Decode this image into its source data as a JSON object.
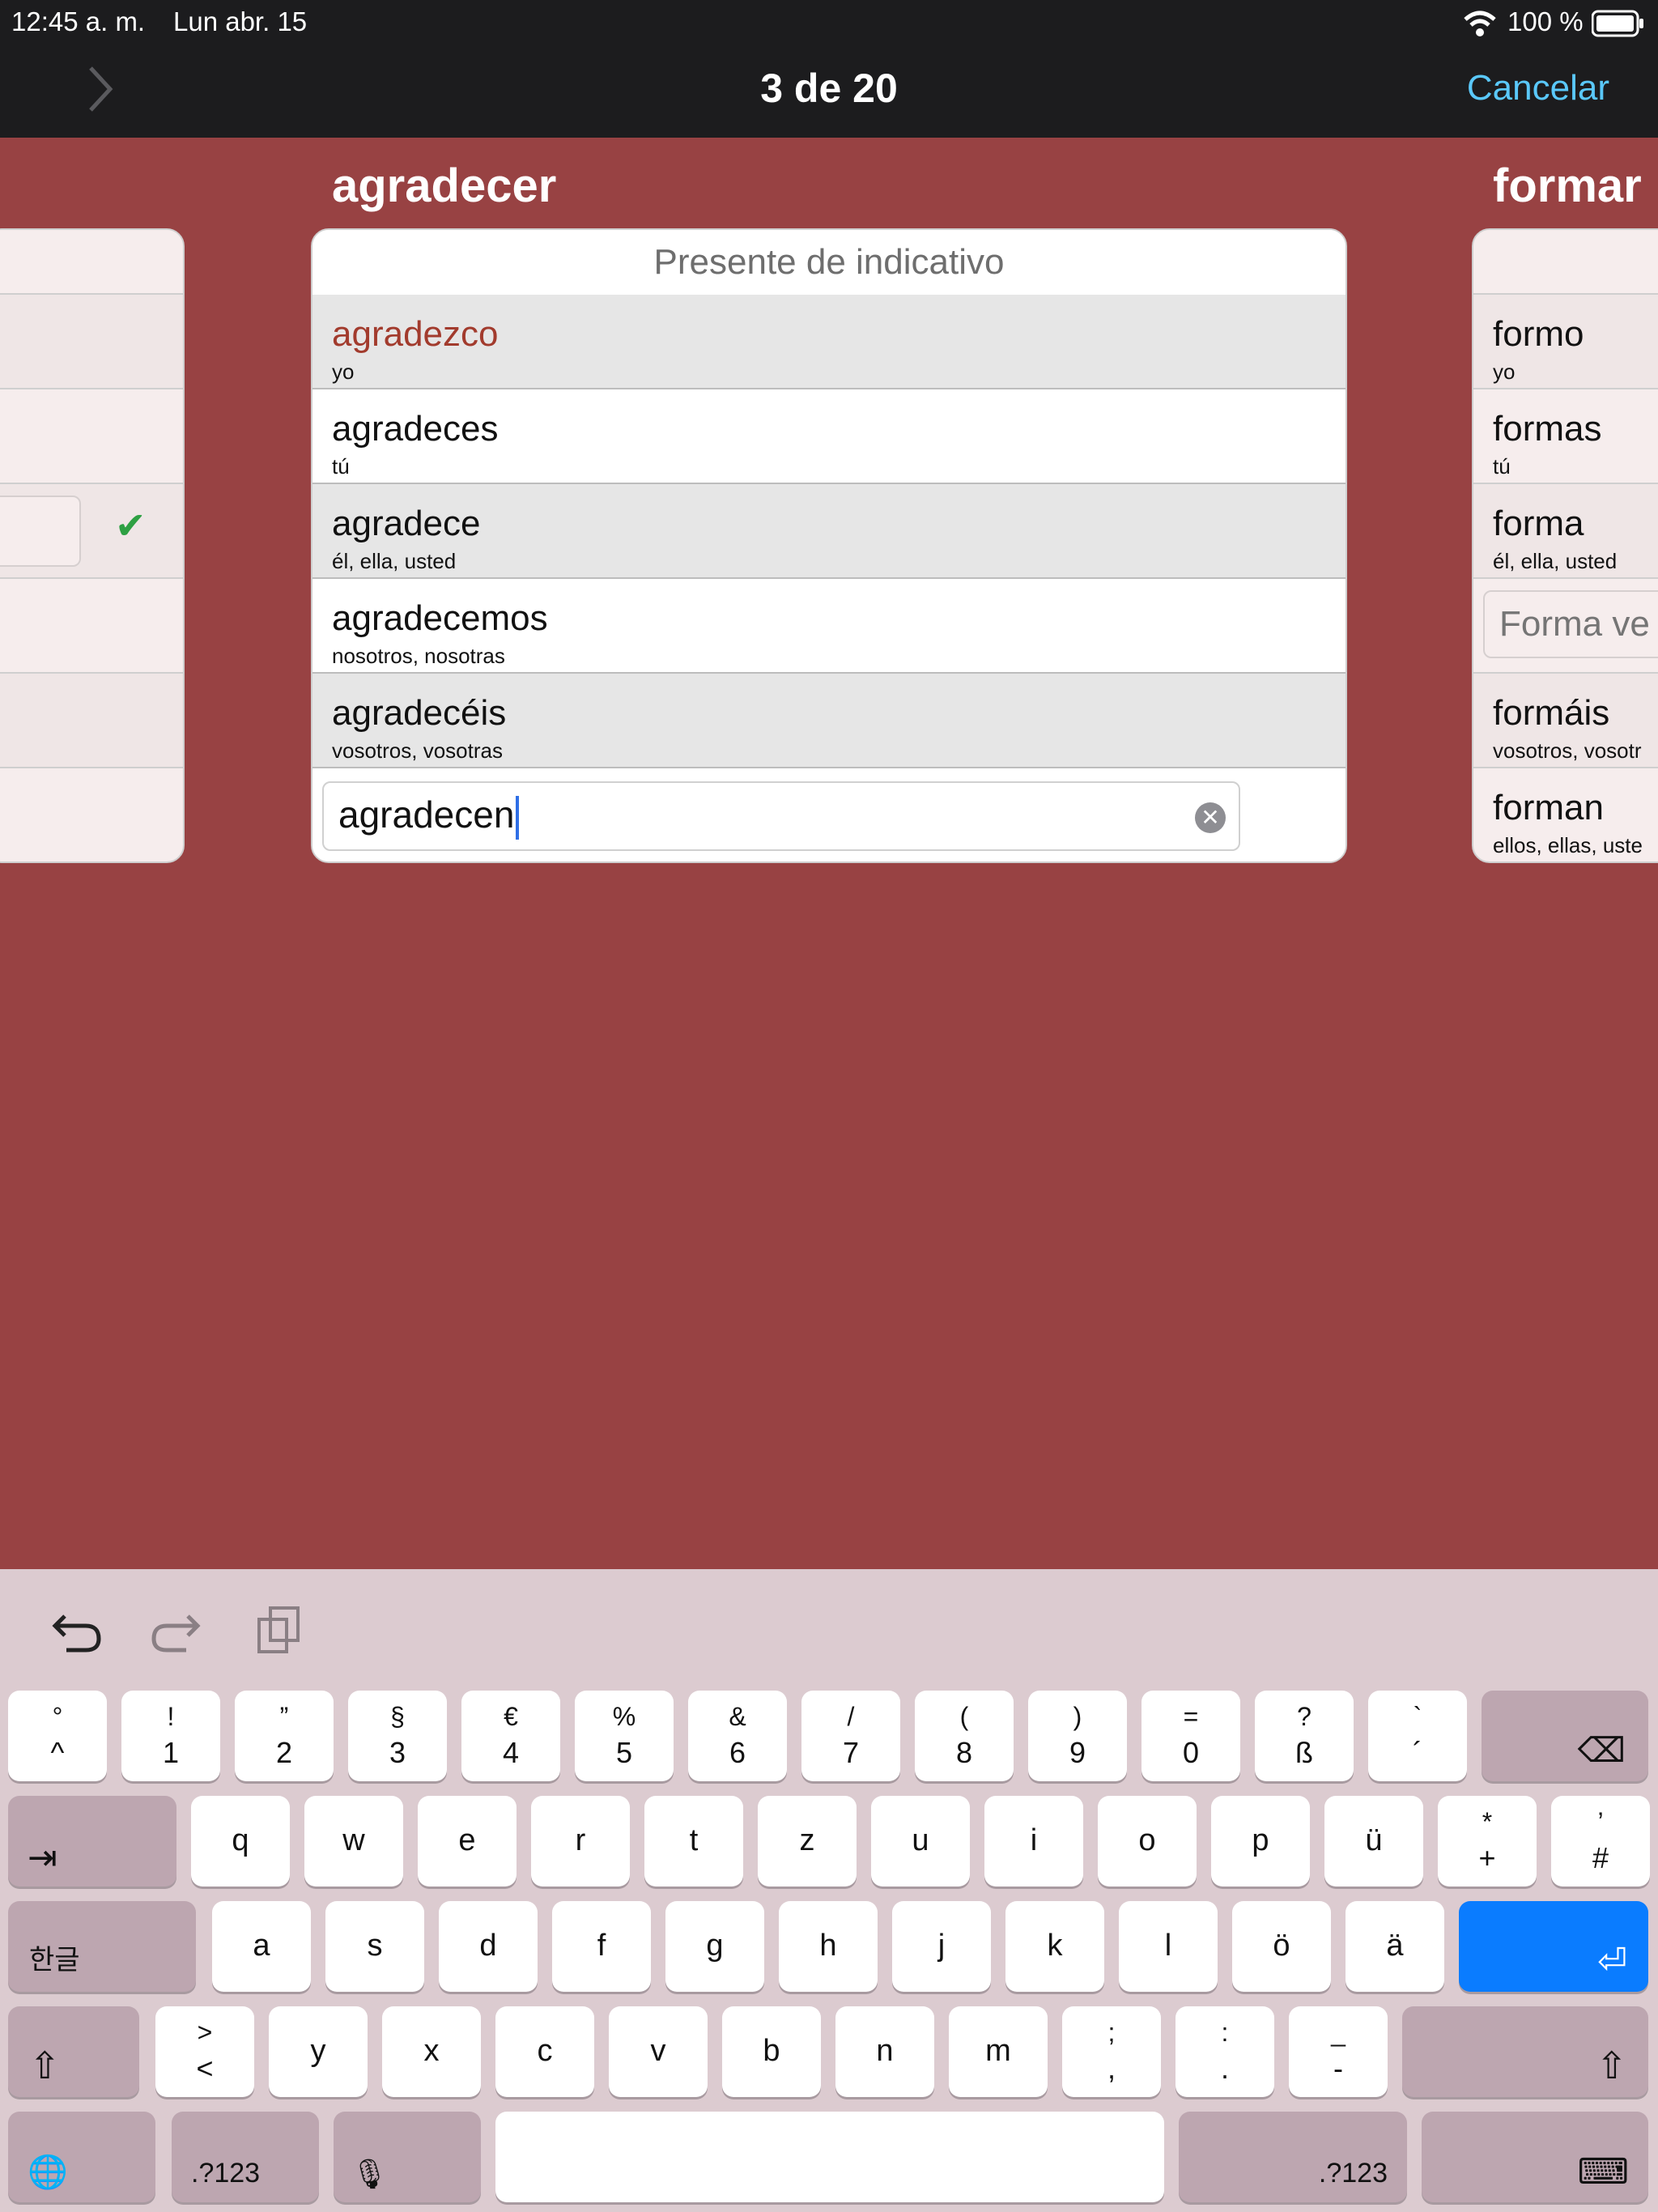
{
  "status": {
    "time": "12:45 a. m.",
    "date": "Lun abr. 15",
    "battery": "100 %"
  },
  "nav": {
    "title": "3 de 20",
    "cancel": "Cancelar",
    "next_icon": "chevron-right-icon"
  },
  "left_card": {
    "check": "✔"
  },
  "main_card": {
    "verb": "agradecer",
    "tense": "Presente de indicativo",
    "rows": [
      {
        "form": "agradezco",
        "pronoun": "yo"
      },
      {
        "form": "agradeces",
        "pronoun": "tú"
      },
      {
        "form": "agradece",
        "pronoun": "él, ella, usted"
      },
      {
        "form": "agradecemos",
        "pronoun": "nosotros, nosotras"
      },
      {
        "form": "agradecéis",
        "pronoun": "vosotros, vosotras"
      }
    ],
    "input_value": "agradecen"
  },
  "right_card": {
    "verb": "formar",
    "rows": [
      {
        "form": "formo",
        "pronoun": "yo"
      },
      {
        "form": "formas",
        "pronoun": "tú"
      },
      {
        "form": "forma",
        "pronoun": "él, ella, usted"
      },
      {
        "form": "",
        "pronoun": ""
      },
      {
        "form": "formáis",
        "pronoun": "vosotros, vosotr"
      },
      {
        "form": "forman",
        "pronoun": "ellos, ellas, uste"
      }
    ],
    "input_placeholder": "Forma ve"
  },
  "keyboard": {
    "row1": [
      {
        "top": "°",
        "bot": "^"
      },
      {
        "top": "!",
        "bot": "1"
      },
      {
        "top": "”",
        "bot": "2"
      },
      {
        "top": "§",
        "bot": "3"
      },
      {
        "top": "€",
        "bot": "4"
      },
      {
        "top": "%",
        "bot": "5"
      },
      {
        "top": "&",
        "bot": "6"
      },
      {
        "top": "/",
        "bot": "7"
      },
      {
        "top": "(",
        "bot": "8"
      },
      {
        "top": ")",
        "bot": "9"
      },
      {
        "top": "=",
        "bot": "0"
      },
      {
        "top": "?",
        "bot": "ß"
      },
      {
        "top": "`",
        "bot": "´"
      }
    ],
    "row2": [
      "q",
      "w",
      "e",
      "r",
      "t",
      "z",
      "u",
      "i",
      "o",
      "p",
      "ü"
    ],
    "row2_extra": [
      {
        "top": "*",
        "bot": "+"
      },
      {
        "top": "’",
        "bot": "#"
      }
    ],
    "row3": [
      "a",
      "s",
      "d",
      "f",
      "g",
      "h",
      "j",
      "k",
      "l",
      "ö",
      "ä"
    ],
    "row4_first": {
      "top": ">",
      "bot": "<"
    },
    "row4": [
      "y",
      "x",
      "c",
      "v",
      "b",
      "n",
      "m"
    ],
    "row4_extra": [
      {
        "top": ";",
        "bot": ","
      },
      {
        "top": ":",
        "bot": "."
      },
      {
        "top": "_",
        "bot": "-"
      }
    ],
    "delete": "⌫",
    "tab": "⇥",
    "lang": "한글",
    "ret": "⏎",
    "shift": "⇧",
    "globe": "🌐",
    "numbers": ".?123",
    "mic": "🎙",
    "hide": "⌨"
  }
}
